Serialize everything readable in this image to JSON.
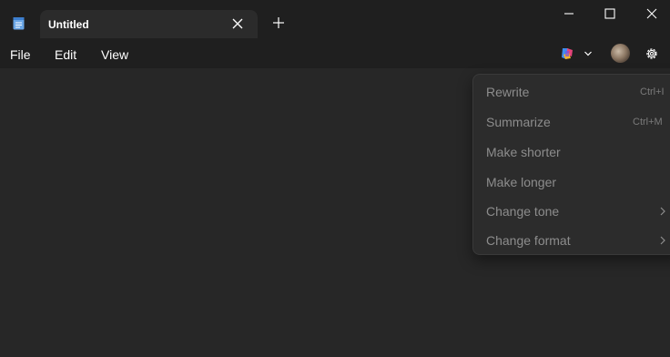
{
  "tab": {
    "title": "Untitled"
  },
  "menubar": {
    "file": "File",
    "edit": "Edit",
    "view": "View"
  },
  "ai_menu": {
    "items": [
      {
        "label": "Rewrite",
        "shortcut": "Ctrl+I"
      },
      {
        "label": "Summarize",
        "shortcut": "Ctrl+M"
      },
      {
        "label": "Make shorter",
        "shortcut": ""
      },
      {
        "label": "Make longer",
        "shortcut": ""
      },
      {
        "label": "Change tone",
        "shortcut": ""
      },
      {
        "label": "Change format",
        "shortcut": ""
      }
    ]
  },
  "icons": {
    "app": "notepad-icon",
    "tab_close": "close-icon",
    "new_tab": "plus-icon",
    "minimize": "minimize-icon",
    "maximize": "maximize-icon",
    "close_window": "close-icon",
    "copilot": "copilot-icon",
    "dropdown": "chevron-down-icon",
    "settings": "gear-icon",
    "submenu": "chevron-right-icon"
  },
  "colors": {
    "titlebar": "#1f1f1f",
    "editor_background": "#272727",
    "menu_background": "#2c2c2c",
    "disabled_text": "#8d8d8d",
    "active_tab": "#2b2b2b"
  }
}
